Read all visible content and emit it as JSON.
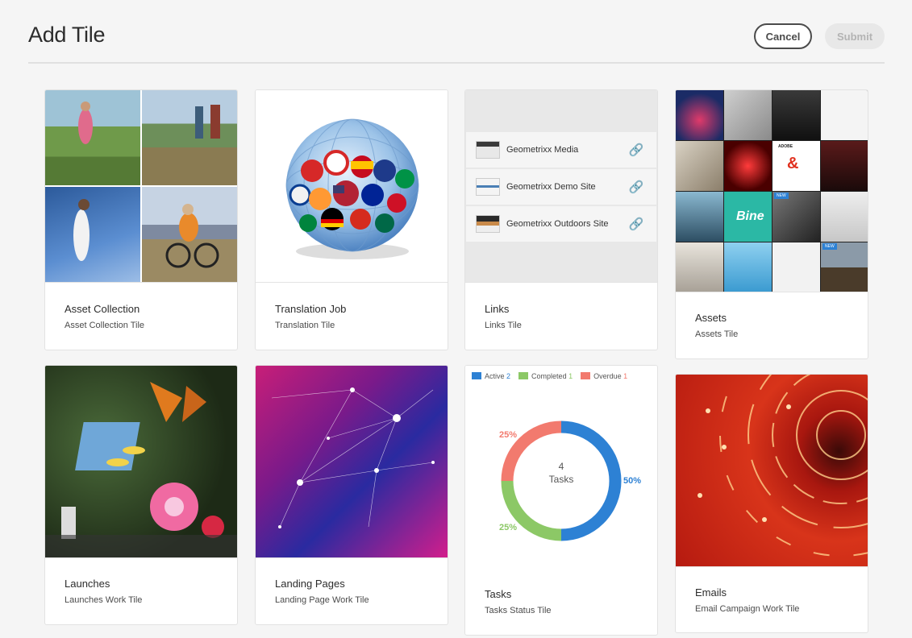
{
  "header": {
    "title": "Add Tile",
    "cancel_label": "Cancel",
    "submit_label": "Submit"
  },
  "cards": [
    {
      "title": "Asset Collection",
      "subtitle": "Asset Collection Tile"
    },
    {
      "title": "Translation Job",
      "subtitle": "Translation Tile"
    },
    {
      "title": "Links",
      "subtitle": "Links Tile"
    },
    {
      "title": "Assets",
      "subtitle": "Assets Tile"
    },
    {
      "title": "Launches",
      "subtitle": "Launches Work Tile"
    },
    {
      "title": "Landing Pages",
      "subtitle": "Landing Page Work Tile"
    },
    {
      "title": "Tasks",
      "subtitle": "Tasks Status Tile"
    },
    {
      "title": "Emails",
      "subtitle": "Email Campaign Work Tile"
    }
  ],
  "links": [
    {
      "label": "Geometrixx Media",
      "icon": "link-icon"
    },
    {
      "label": "Geometrixx Demo Site",
      "icon": "link-icon"
    },
    {
      "label": "Geometrixx Outdoors Site",
      "icon": "link-icon"
    }
  ],
  "assets_badges": {
    "new1": "NEW",
    "new2": "NEW",
    "brand_text": "Bine",
    "adobe_text": "ADOBE"
  },
  "tasks": {
    "legend": [
      {
        "label": "Active",
        "count": "2",
        "color": "#2d81d4"
      },
      {
        "label": "Completed",
        "count": "1",
        "color": "#8cc866"
      },
      {
        "label": "Overdue",
        "count": "1",
        "color": "#f27a6e"
      }
    ],
    "center_count": "4",
    "center_label": "Tasks",
    "pct_active": "50%",
    "pct_completed": "25%",
    "pct_overdue": "25%"
  },
  "chart_data": {
    "type": "pie",
    "categories": [
      "Active",
      "Completed",
      "Overdue"
    ],
    "values": [
      2,
      1,
      1
    ],
    "title": ""
  },
  "colors": {
    "accent": "#2d81d4",
    "completed": "#8cc866",
    "overdue": "#f27a6e"
  }
}
